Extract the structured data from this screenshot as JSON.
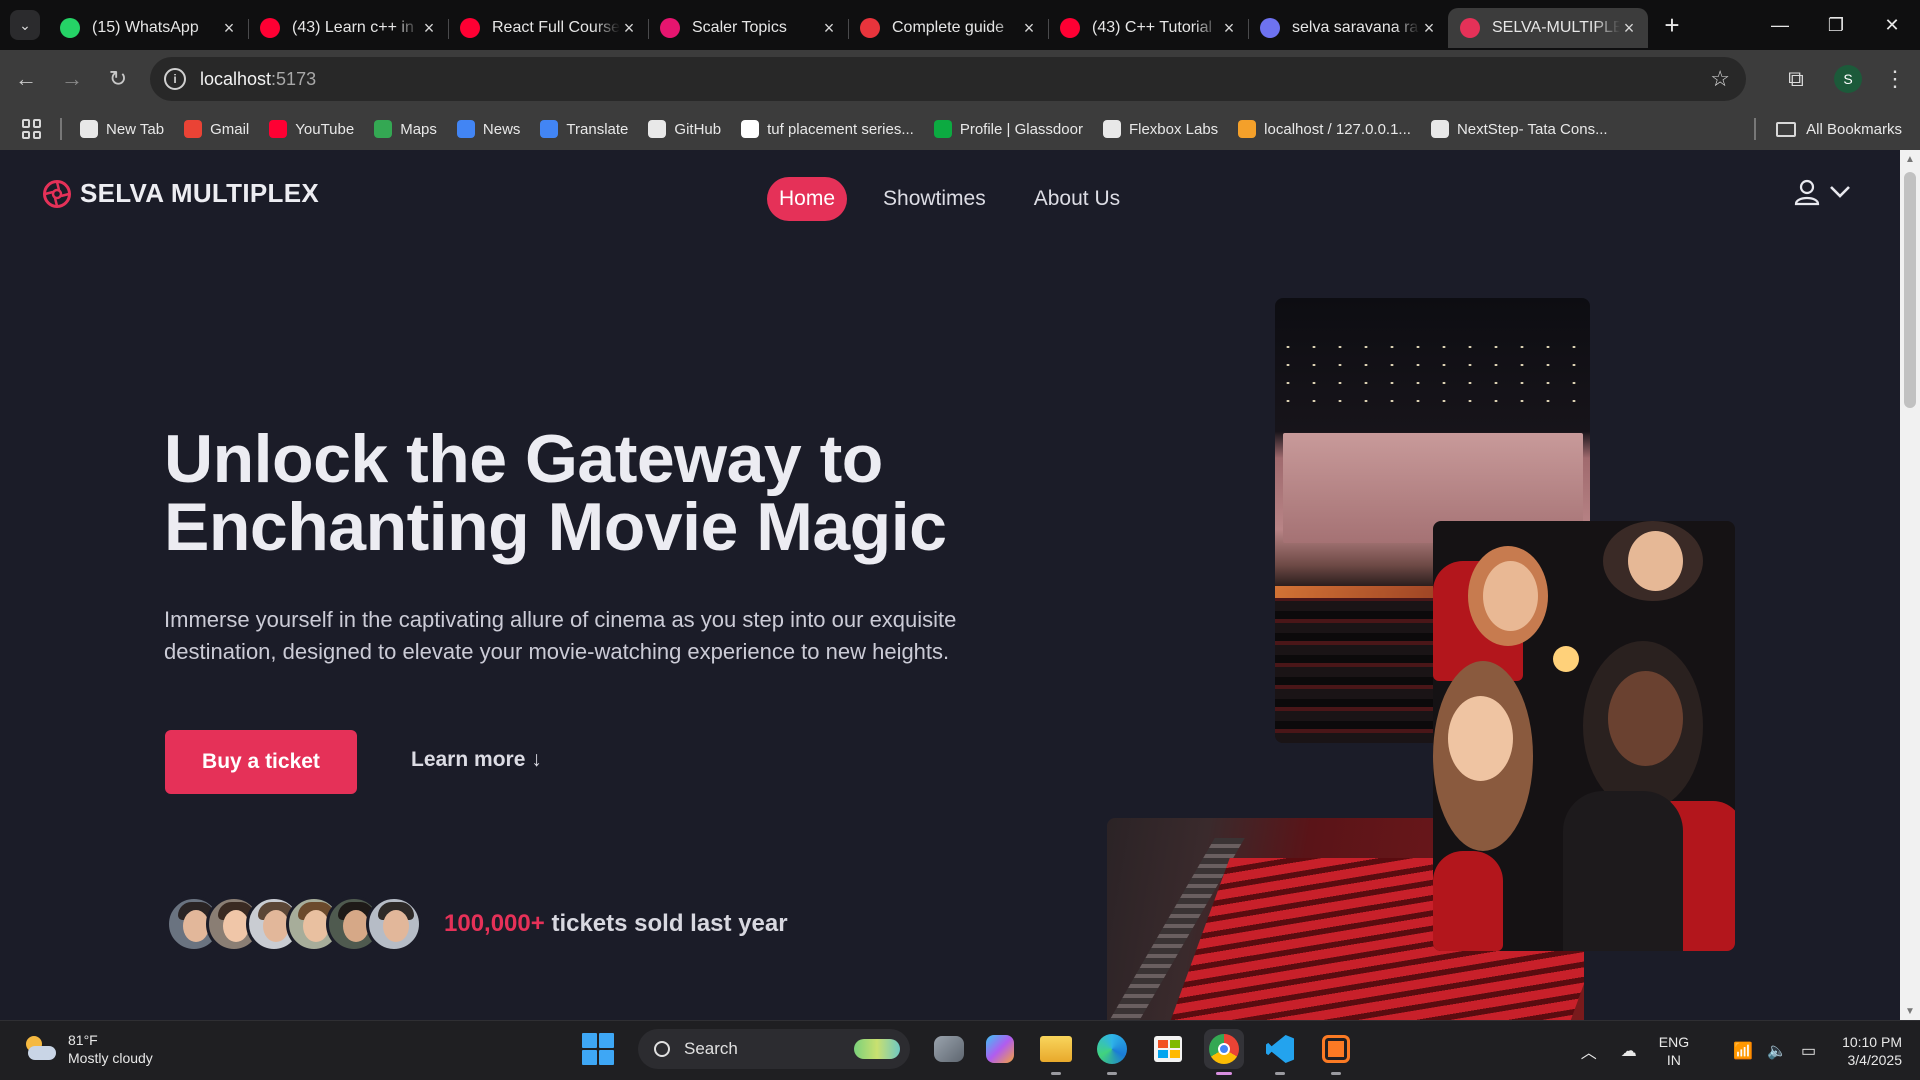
{
  "browser": {
    "tabs": [
      {
        "title": "(15) WhatsApp",
        "favicon": "whatsapp-icon",
        "color": "#25d366",
        "active": false
      },
      {
        "title": "(43) Learn c++ in",
        "favicon": "youtube-icon",
        "color": "#ff0033",
        "active": false
      },
      {
        "title": "React Full Course",
        "favicon": "youtube-icon",
        "color": "#ff0033",
        "active": false
      },
      {
        "title": "Scaler Topics",
        "favicon": "scaler-icon",
        "color": "#e6156f",
        "active": false
      },
      {
        "title": "Complete guide",
        "favicon": "codechef-icon",
        "color": "#e8343c",
        "active": false
      },
      {
        "title": "(43) C++ Tutorial",
        "favicon": "youtube-icon",
        "color": "#ff0033",
        "active": false
      },
      {
        "title": "selva saravana ra",
        "favicon": "gemini-icon",
        "color": "#6e72f0",
        "active": false
      },
      {
        "title": "SELVA-MULTIPLE",
        "favicon": "site-logo-icon",
        "color": "#e53158",
        "active": true
      }
    ],
    "url_host": "localhost",
    "url_port": ":5173",
    "profile_initial": "S",
    "bookmarks": [
      {
        "label": "New Tab",
        "icon": "chrome-icon",
        "color": "#e8e8e8"
      },
      {
        "label": "Gmail",
        "icon": "gmail-icon",
        "color": "#ea4335"
      },
      {
        "label": "YouTube",
        "icon": "youtube-icon",
        "color": "#ff0033"
      },
      {
        "label": "Maps",
        "icon": "maps-icon",
        "color": "#34a853"
      },
      {
        "label": "News",
        "icon": "news-icon",
        "color": "#4285f4"
      },
      {
        "label": "Translate",
        "icon": "translate-icon",
        "color": "#4285f4"
      },
      {
        "label": "GitHub",
        "icon": "github-icon",
        "color": "#e8e8e8"
      },
      {
        "label": "tuf placement series...",
        "icon": "google-icon",
        "color": "#ffffff"
      },
      {
        "label": "Profile | Glassdoor",
        "icon": "glassdoor-icon",
        "color": "#0caa41"
      },
      {
        "label": "Flexbox Labs",
        "icon": "flexbox-icon",
        "color": "#e8e8e8"
      },
      {
        "label": "localhost / 127.0.0.1...",
        "icon": "phpmyadmin-icon",
        "color": "#f4a02a"
      },
      {
        "label": "NextStep- Tata Cons...",
        "icon": "tcs-icon",
        "color": "#e8e8e8"
      }
    ],
    "all_bookmarks": "All Bookmarks"
  },
  "site": {
    "brand": "SELVA MULTIPLEX",
    "accent": "#e53158",
    "nav": [
      {
        "label": "Home",
        "active": true
      },
      {
        "label": "Showtimes",
        "active": false
      },
      {
        "label": "About Us",
        "active": false
      }
    ],
    "hero": {
      "title": "Unlock the Gateway to Enchanting Movie Magic",
      "description": "Immerse yourself in the captivating allure of cinema as you step into our exquisite destination, designed to elevate your movie-watching experience to new heights.",
      "buy_label": "Buy a ticket",
      "learn_label": "Learn more ↓"
    },
    "stats": {
      "number": "100,000+",
      "text": "tickets sold last year"
    }
  },
  "taskbar": {
    "weather_temp": "81°F",
    "weather_desc": "Mostly cloudy",
    "search_placeholder": "Search",
    "lang_top": "ENG",
    "lang_bottom": "IN",
    "time": "10:10 PM",
    "date": "3/4/2025"
  }
}
